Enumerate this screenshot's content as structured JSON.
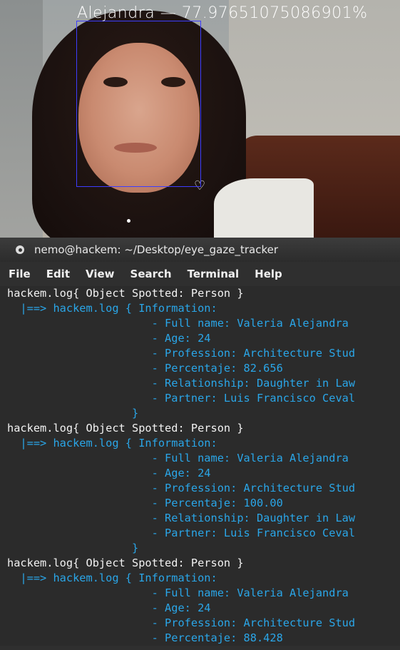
{
  "camera": {
    "face_label": "Alejandra — 77.97651075086901%"
  },
  "terminal": {
    "title": "nemo@hackem: ~/Desktop/eye_gaze_tracker",
    "menu": [
      "File",
      "Edit",
      "View",
      "Search",
      "Terminal",
      "Help"
    ],
    "lines": [
      {
        "text": "hackem.log{ Object Spotted: Person }",
        "color": "white"
      },
      {
        "text": "  |==> hackem.log { Information:",
        "color": "blue"
      },
      {
        "text": "                      - Full name: Valeria Alejandra ",
        "color": "blue"
      },
      {
        "text": "                      - Age: 24",
        "color": "blue"
      },
      {
        "text": "                      - Profession: Architecture Stud",
        "color": "blue"
      },
      {
        "text": "                      - Percentaje: 82.656",
        "color": "blue"
      },
      {
        "text": "                      - Relationship: Daughter in Law",
        "color": "blue"
      },
      {
        "text": "                      - Partner: Luis Francisco Ceval",
        "color": "blue"
      },
      {
        "text": "                   }",
        "color": "blue"
      },
      {
        "text": "hackem.log{ Object Spotted: Person }",
        "color": "white"
      },
      {
        "text": "  |==> hackem.log { Information:",
        "color": "blue"
      },
      {
        "text": "                      - Full name: Valeria Alejandra ",
        "color": "blue"
      },
      {
        "text": "                      - Age: 24",
        "color": "blue"
      },
      {
        "text": "                      - Profession: Architecture Stud",
        "color": "blue"
      },
      {
        "text": "                      - Percentaje: 100.00",
        "color": "blue"
      },
      {
        "text": "                      - Relationship: Daughter in Law",
        "color": "blue"
      },
      {
        "text": "                      - Partner: Luis Francisco Ceval",
        "color": "blue"
      },
      {
        "text": "                   }",
        "color": "blue"
      },
      {
        "text": "hackem.log{ Object Spotted: Person }",
        "color": "white"
      },
      {
        "text": "  |==> hackem.log { Information:",
        "color": "blue"
      },
      {
        "text": "                      - Full name: Valeria Alejandra ",
        "color": "blue"
      },
      {
        "text": "                      - Age: 24",
        "color": "blue"
      },
      {
        "text": "                      - Profession: Architecture Stud",
        "color": "blue"
      },
      {
        "text": "                      - Percentaje: 88.428",
        "color": "blue"
      }
    ]
  },
  "colors": {
    "log_white": "#f2f2f2",
    "log_blue": "#2aa6e8",
    "face_box": "#3d3dff"
  }
}
